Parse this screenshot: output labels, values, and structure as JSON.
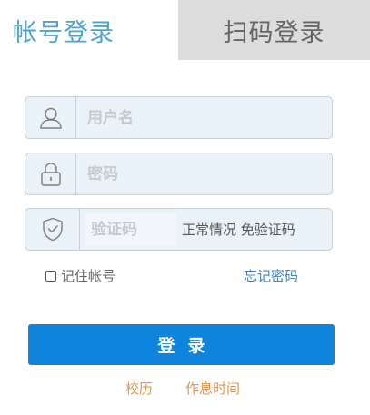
{
  "tabs": {
    "account_login": "帐号登录",
    "qr_login": "扫码登录"
  },
  "form": {
    "username_placeholder": "用户名",
    "password_placeholder": "密码",
    "captcha_placeholder": "验证码",
    "captcha_hint": "正常情况 免验证码",
    "remember_label": "记住帐号",
    "forgot_label": "忘记密码",
    "login_label": "登录"
  },
  "links": {
    "calendar": "校历",
    "schedule": "作息时间"
  },
  "icons": {
    "user": "user-icon",
    "lock": "lock-icon",
    "shield": "shield-check-icon"
  },
  "colors": {
    "active_tab": "#4ea2d0",
    "inactive_tab_bg": "#dcdcdc",
    "field_bg": "#e9f2f9",
    "primary_button": "#0e84dd",
    "forgot_link": "#3e84c5",
    "bottom_link": "#e8944a"
  }
}
